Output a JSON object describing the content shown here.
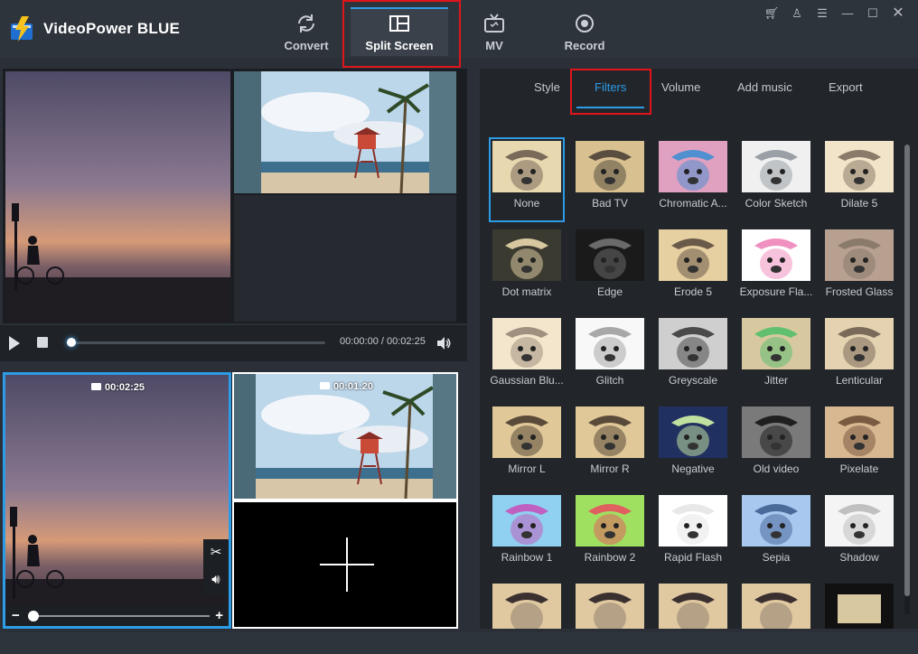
{
  "app": {
    "title": "VideoPower BLUE",
    "accent_color": "#2e9be6",
    "highlight_color": "#e0151b"
  },
  "nav": {
    "tabs": [
      {
        "label": "Convert",
        "icon": "convert-icon"
      },
      {
        "label": "Split Screen",
        "icon": "split-screen-icon",
        "active": true
      },
      {
        "label": "MV",
        "icon": "tv-icon"
      },
      {
        "label": "Record",
        "icon": "record-icon"
      }
    ]
  },
  "window_controls": [
    "cart-icon",
    "user-icon",
    "menu-icon",
    "minimize-icon",
    "maximize-icon",
    "close-icon"
  ],
  "player": {
    "time": "00:00:00 / 00:02:25",
    "progress": 0
  },
  "split": {
    "left_duration": "00:02:25",
    "right_duration": "00:01:20",
    "zoom_minus": "−",
    "zoom_plus": "+"
  },
  "subtabs": [
    {
      "label": "Style"
    },
    {
      "label": "Filters",
      "active": true
    },
    {
      "label": "Volume"
    },
    {
      "label": "Add music"
    },
    {
      "label": "Export"
    }
  ],
  "filters": [
    "None",
    "Bad TV",
    "Chromatic A...",
    "Color Sketch",
    "Dilate 5",
    "Dot matrix",
    "Edge",
    "Erode 5",
    "Exposure Fla...",
    "Frosted Glass",
    "Gaussian Blu...",
    "Glitch",
    "Greyscale",
    "Jitter",
    "Lenticular",
    "Mirror L",
    "Mirror R",
    "Negative",
    "Old video",
    "Pixelate",
    "Rainbow 1",
    "Rainbow 2",
    "Rapid Flash",
    "Sepia",
    "Shadow"
  ],
  "selected_filter": "None"
}
